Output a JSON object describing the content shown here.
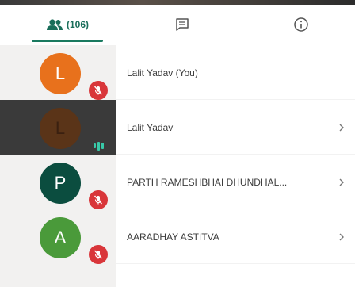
{
  "tabs": {
    "people_count": "(106)",
    "people_icon": "people-icon",
    "chat_icon": "chat-icon",
    "info_icon": "info-icon",
    "active_color": "#1a7a60"
  },
  "participants": [
    {
      "initial": "L",
      "name": "Lalit Yadav (You)",
      "avatar_color": "#e8711c",
      "status": "muted",
      "has_chevron": false
    },
    {
      "initial": "L",
      "name": "Lalit Yadav",
      "avatar_color": "#5a3418",
      "status": "speaking",
      "has_chevron": true
    },
    {
      "initial": "P",
      "name": "PARTH RAMESHBHAI DHUNDHAL...",
      "avatar_color": "#0b4d3f",
      "status": "muted",
      "has_chevron": true
    },
    {
      "initial": "A",
      "name": "AARADHAY ASTITVA",
      "avatar_color": "#4a9a3a",
      "status": "muted",
      "has_chevron": true
    }
  ],
  "colors": {
    "mic_off": "#d9363a",
    "speaking_bars": "#38c9a8"
  }
}
